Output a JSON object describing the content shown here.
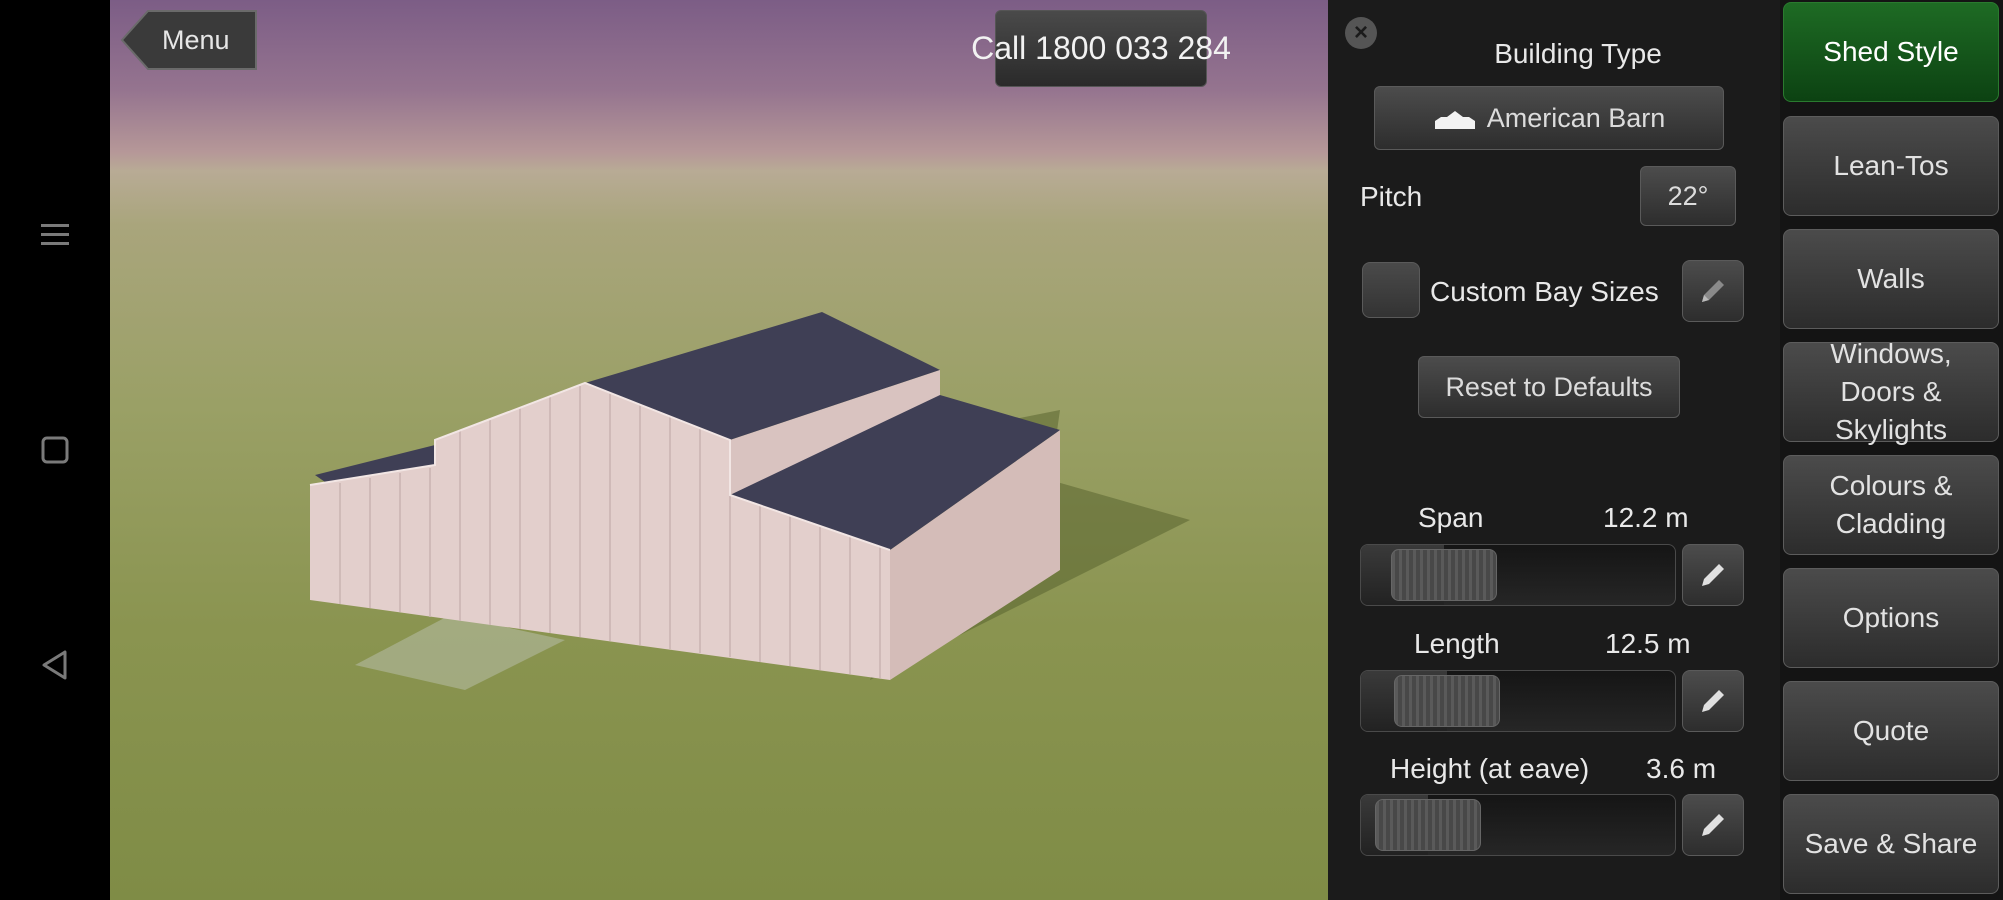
{
  "viewport": {
    "menu_label": "Menu",
    "call_label": "Call 1800 033 284"
  },
  "panel": {
    "building_type_label": "Building Type",
    "building_type_value": "American Barn",
    "pitch_label": "Pitch",
    "pitch_value": "22°",
    "custom_bay_label": "Custom Bay Sizes",
    "reset_label": "Reset to Defaults",
    "sliders": [
      {
        "label": "Span",
        "value": "12.2 m",
        "level": 0.27
      },
      {
        "label": "Length",
        "value": "12.5 m",
        "level": 0.28
      },
      {
        "label": "Height (at eave)",
        "value": "3.6 m",
        "level": 0.22
      }
    ]
  },
  "right_menu": {
    "items": [
      {
        "label": "Shed Style",
        "active": true
      },
      {
        "label": "Lean-Tos"
      },
      {
        "label": "Walls"
      },
      {
        "label": "Windows, Doors & Skylights"
      },
      {
        "label": "Colours & Cladding"
      },
      {
        "label": "Options"
      },
      {
        "label": "Quote"
      },
      {
        "label": "Save & Share"
      }
    ]
  },
  "colors": {
    "active_green": "#1e6b24",
    "roof": "#3f3f55",
    "walls": "#e3cfcc"
  }
}
